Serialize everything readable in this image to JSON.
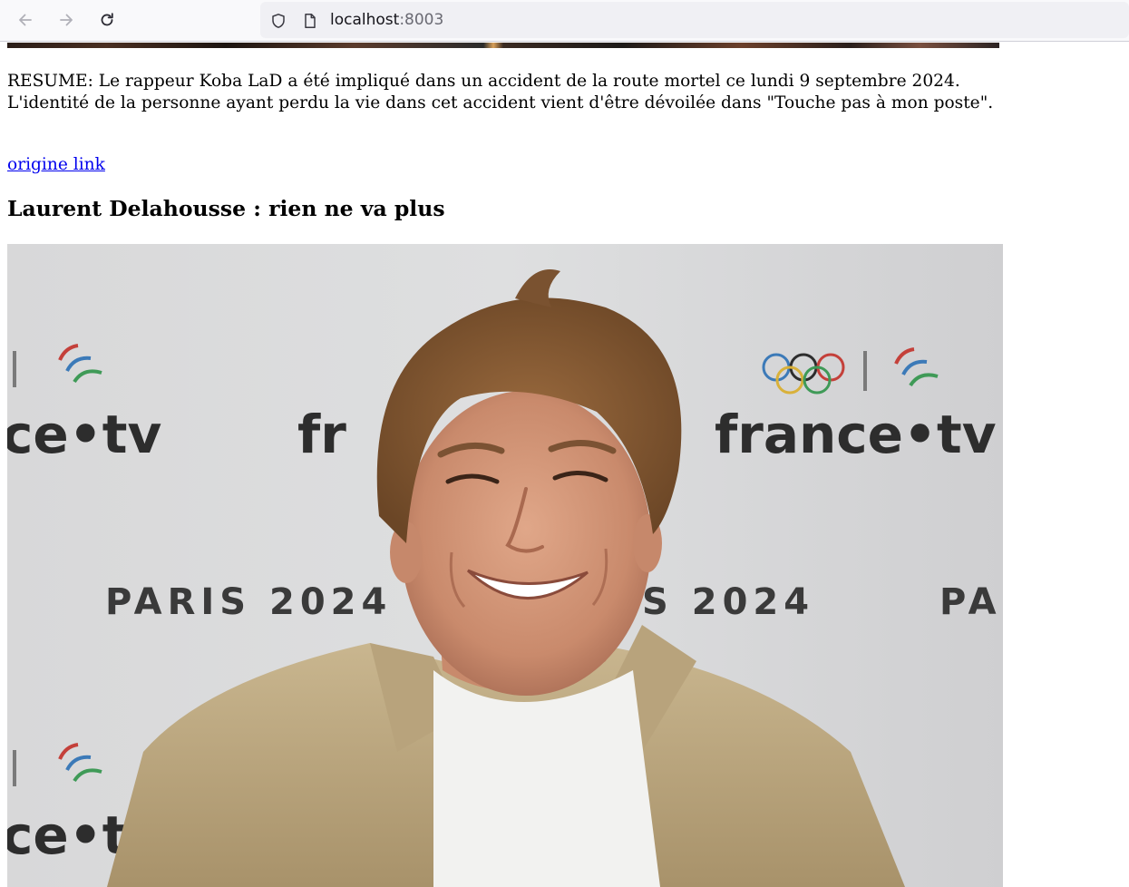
{
  "browser": {
    "url_host": "localhost",
    "url_port": ":8003"
  },
  "article": {
    "summary": "RESUME: Le rappeur Koba LaD a été impliqué dans un accident de la route mortel ce lundi 9 septembre 2024. L'identité de la personne ayant perdu la vie dans cet accident vient d'être dévoilée dans \"Touche pas à mon poste\".",
    "origin_link_label": "origine link",
    "next_title": "Laurent Delahousse : rien ne va plus"
  },
  "photo": {
    "backdrop_brand": "france•tv",
    "backdrop_brand_partial": "ce•tv",
    "backdrop_brand_partial_2": "fr",
    "backdrop_event": "PARIS 2024",
    "backdrop_event_partial": "PA",
    "backdrop_event_partial_2": "S 2024"
  }
}
